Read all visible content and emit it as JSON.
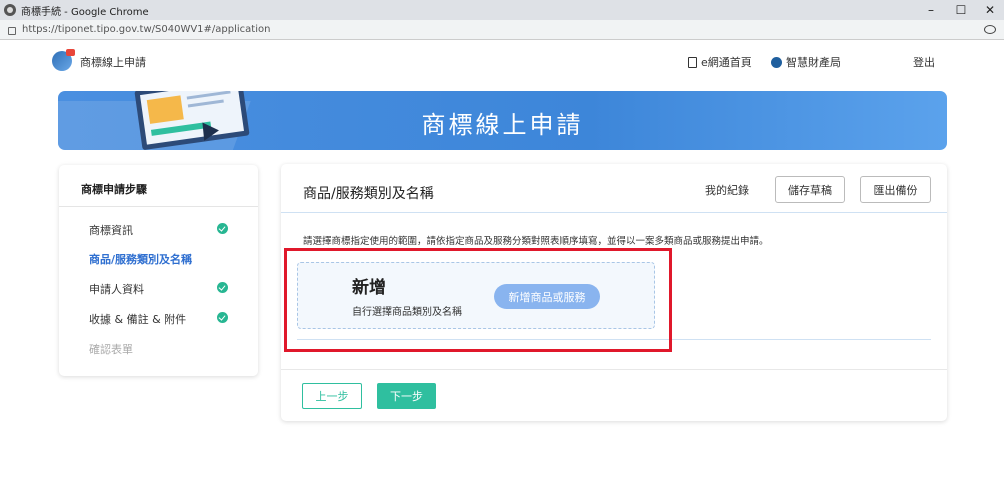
{
  "browser": {
    "window_title": "商標手続 - Google Chrome",
    "url": "https://tiponet.tipo.gov.tw/S040WV1#/application",
    "controls": {
      "minimize": "–",
      "maximize": "☐",
      "close": "✕"
    }
  },
  "header": {
    "site_name": "商標線上申請",
    "nav": {
      "home": "e網通首頁",
      "tipo": "智慧財產局",
      "logout": "登出"
    }
  },
  "banner": {
    "title": "商標線上申請"
  },
  "sidebar": {
    "title": "商標申請步驟",
    "steps": [
      {
        "label": "商標資訊",
        "status": "done"
      },
      {
        "label": "商品/服務類別及名稱",
        "status": "active"
      },
      {
        "label": "申請人資料",
        "status": "done"
      },
      {
        "label": "收據 & 備註 & 附件",
        "status": "done"
      },
      {
        "label": "確認表單",
        "status": "disabled"
      }
    ]
  },
  "main": {
    "title": "商品/服務類別及名稱",
    "my_record": "我的紀錄",
    "save_draft": "儲存草稿",
    "export_backup": "匯出備份",
    "instruction": "請選擇商標指定使用的範圍，請依指定商品及服務分類對照表順序填寫，並得以一案多類商品或服務提出申請。",
    "add_box": {
      "title": "新增",
      "subtitle": "自行選擇商品類別及名稱",
      "button": "新增商品或服務"
    },
    "prev": "上一步",
    "next": "下一步"
  },
  "colors": {
    "accent_green": "#2fbf9f",
    "active_blue": "#2f6fd0",
    "banner_blue": "#3d86d9",
    "highlight_red": "#e0182b"
  }
}
